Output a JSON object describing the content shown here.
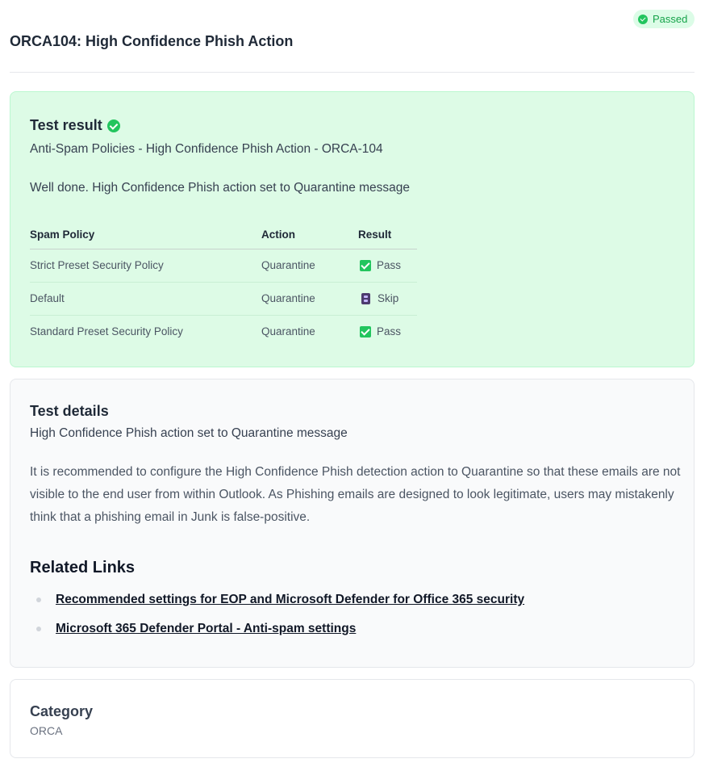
{
  "status": {
    "label": "Passed",
    "color": "#22c55e"
  },
  "page": {
    "title": "ORCA104: High Confidence Phish Action"
  },
  "result": {
    "heading": "Test result",
    "subtitle": "Anti-Spam Policies - High Confidence Phish Action - ORCA-104",
    "message": "Well done. High Confidence Phish action set to Quarantine message",
    "table": {
      "headers": [
        "Spam Policy",
        "Action",
        "Result"
      ],
      "rows": [
        {
          "policy": "Strict Preset Security Policy",
          "action": "Quarantine",
          "result": "Pass",
          "icon": "check-box-icon"
        },
        {
          "policy": "Default",
          "action": "Quarantine",
          "result": "Skip",
          "icon": "skip-icon"
        },
        {
          "policy": "Standard Preset Security Policy",
          "action": "Quarantine",
          "result": "Pass",
          "icon": "check-box-icon"
        }
      ]
    }
  },
  "details": {
    "heading": "Test details",
    "subtitle": "High Confidence Phish action set to Quarantine message",
    "body": "It is recommended to configure the High Confidence Phish detection action to Quarantine so that these emails are not visible to the end user from within Outlook. As Phishing emails are designed to look legitimate, users may mistakenly think that a phishing email in Junk is false-positive.",
    "links_heading": "Related Links",
    "links": [
      "Recommended settings for EOP and Microsoft Defender for Office 365 security",
      "Microsoft 365 Defender Portal - Anti-spam settings"
    ]
  },
  "category": {
    "heading": "Category",
    "value": "ORCA"
  }
}
